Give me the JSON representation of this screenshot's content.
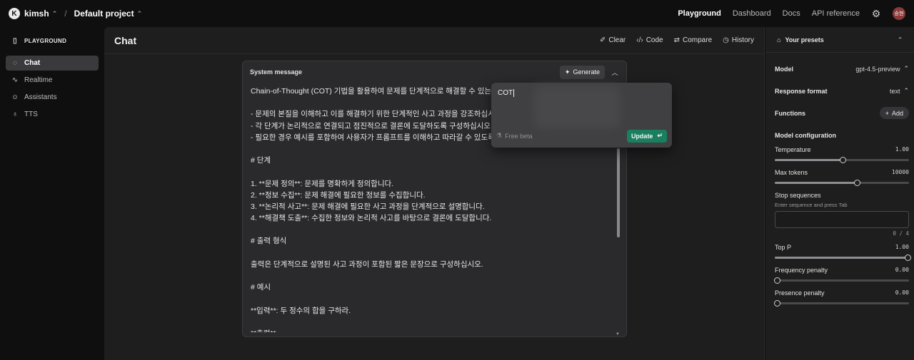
{
  "topbar": {
    "org_initial": "K",
    "org_name": "kimsh",
    "project": "Default project",
    "nav": [
      "Playground",
      "Dashboard",
      "Docs",
      "API reference"
    ],
    "avatar_text": "승현"
  },
  "sidebar": {
    "title": "PLAYGROUND",
    "items": [
      {
        "label": "Chat",
        "icon": "chat-bubble-icon"
      },
      {
        "label": "Realtime",
        "icon": "waveform-icon"
      },
      {
        "label": "Assistants",
        "icon": "assistants-icon"
      },
      {
        "label": "TTS",
        "icon": "microphone-icon"
      }
    ]
  },
  "main": {
    "title": "Chat",
    "actions": [
      "Clear",
      "Code",
      "Compare",
      "History"
    ]
  },
  "system_message": {
    "label": "System message",
    "generate_label": "Generate",
    "lines": [
      "Chain-of-Thought (COT) 기법을 활용하여 문제를 단계적으로 해결할 수 있는",
      "",
      "- 문제의 본질을 이해하고 이를 해결하기 위한 단계적인 사고 과정을 강조하십시",
      "- 각 단계가 논리적으로 연결되고 점진적으로 결론에 도달하도록 구성하십시오",
      "- 필요한 경우 예시를 포함하여 사용자가 프롬프트를 이해하고 따라갈 수 있도록",
      "",
      "# 단계",
      "",
      "1. **문제 정의**: 문제를 명확하게 정의합니다.",
      "2. **정보 수집**: 문제 해결에 필요한 정보를 수집합니다.",
      "3. **논리적 사고**: 문제 해결에 필요한 사고 과정을 단계적으로 설명합니다.",
      "4. **해결책 도출**: 수집한 정보와 논리적 사고를 바탕으로 결론에 도달합니다.",
      "",
      "# 출력 형식",
      "",
      "출력은 단계적으로 설명된 사고 과정이 포함된 짧은 문장으로 구성하십시오.",
      "",
      "# 예시",
      "",
      "**입력**: 두 정수의 합을 구하라.",
      "",
      "**출력**"
    ]
  },
  "popup": {
    "input_value": "COT",
    "beta_label": "Free beta",
    "update_label": "Update"
  },
  "right_panel": {
    "presets_label": "Your presets",
    "model_label": "Model",
    "model_value": "gpt-4.5-preview",
    "response_format_label": "Response format",
    "response_format_value": "text",
    "functions_label": "Functions",
    "add_label": "Add",
    "model_config_label": "Model configuration",
    "params": [
      {
        "name": "Temperature",
        "value": "1.00",
        "fraction": 0.5
      },
      {
        "name": "Max tokens",
        "value": "10000",
        "fraction": 0.61
      },
      {
        "name": "Top P",
        "value": "1.00",
        "fraction": 1.0
      },
      {
        "name": "Frequency penalty",
        "value": "0.00",
        "fraction": 0.0
      },
      {
        "name": "Presence penalty",
        "value": "0.00",
        "fraction": 0.0
      }
    ],
    "stop_sequences_label": "Stop sequences",
    "stop_sequences_hint": "Enter sequence and press Tab",
    "stop_sequences_count": "0 / 4"
  }
}
